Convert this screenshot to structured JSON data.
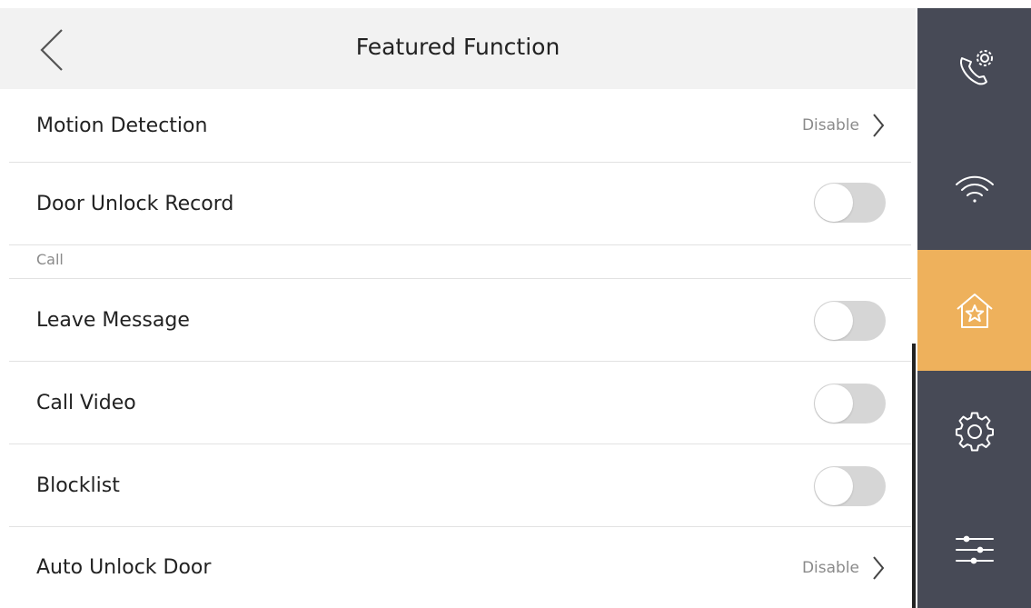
{
  "header": {
    "title": "Featured Function"
  },
  "rows": {
    "motion_detection": {
      "label": "Motion Detection",
      "value": "Disable"
    },
    "door_unlock_record": {
      "label": "Door Unlock Record",
      "on": false
    },
    "section_call": {
      "label": "Call"
    },
    "leave_message": {
      "label": "Leave Message",
      "on": false
    },
    "call_video": {
      "label": "Call Video",
      "on": false
    },
    "blocklist": {
      "label": "Blocklist",
      "on": false
    },
    "auto_unlock_door": {
      "label": "Auto Unlock Door",
      "value": "Disable"
    }
  },
  "sidebar": {
    "items": [
      {
        "icon": "phone-settings-icon",
        "active": false
      },
      {
        "icon": "wifi-icon",
        "active": false
      },
      {
        "icon": "home-star-icon",
        "active": true
      },
      {
        "icon": "gear-icon",
        "active": false
      },
      {
        "icon": "sliders-icon",
        "active": false
      }
    ]
  },
  "colors": {
    "sidebar_bg": "#474a56",
    "sidebar_active": "#eeb15c",
    "header_bg": "#f2f2f2",
    "toggle_off": "#d6d6d6",
    "secondary_text": "#8a8a8a"
  }
}
